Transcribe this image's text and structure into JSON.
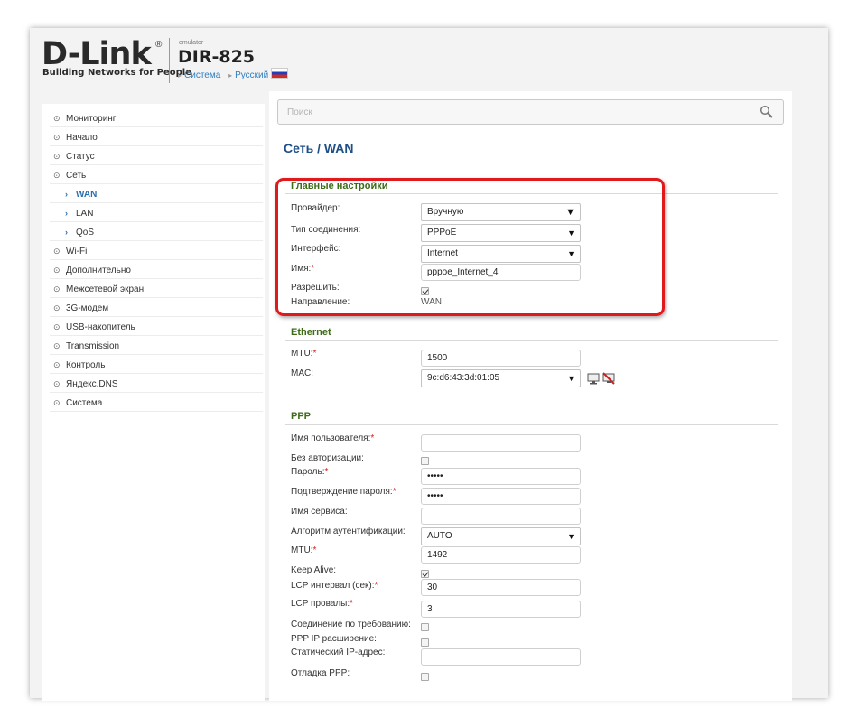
{
  "header": {
    "brand": "D-Link",
    "registered": "®",
    "tagline": "Building Networks for People",
    "emulator_label": "emulator",
    "model": "DIR-825",
    "link_system": "Система",
    "link_language": "Русский"
  },
  "sidebar": {
    "items": [
      {
        "label": "Мониторинг"
      },
      {
        "label": "Начало"
      },
      {
        "label": "Статус"
      },
      {
        "label": "Сеть"
      },
      {
        "label": "WAN"
      },
      {
        "label": "LAN"
      },
      {
        "label": "QoS"
      },
      {
        "label": "Wi-Fi"
      },
      {
        "label": "Дополнительно"
      },
      {
        "label": "Межсетевой экран"
      },
      {
        "label": "3G-модем"
      },
      {
        "label": "USB-накопитель"
      },
      {
        "label": "Transmission"
      },
      {
        "label": "Контроль"
      },
      {
        "label": "Яндекс.DNS"
      },
      {
        "label": "Система"
      }
    ]
  },
  "search": {
    "placeholder": "Поиск"
  },
  "page": {
    "title": "Сеть /  WAN"
  },
  "main_settings": {
    "heading": "Главные настройки",
    "provider_label": "Провайдер:",
    "provider_value": "Вручную",
    "conn_type_label": "Тип соединения:",
    "conn_type_value": "PPPoE",
    "interface_label": "Интерфейс:",
    "interface_value": "Internet",
    "name_label": "Имя:",
    "name_value": "pppoe_Internet_4",
    "enable_label": "Разрешить:",
    "enable_checked": true,
    "direction_label": "Направление:",
    "direction_value": "WAN"
  },
  "ethernet": {
    "heading": "Ethernet",
    "mtu_label": "MTU:",
    "mtu_value": "1500",
    "mac_label": "MAC:",
    "mac_value": "9c:d6:43:3d:01:05"
  },
  "ppp": {
    "heading": "PPP",
    "username_label": "Имя пользователя:",
    "username_value": "",
    "noauth_label": "Без авторизации:",
    "password_label": "Пароль:",
    "password_value": "•••••",
    "confirm_label": "Подтверждение пароля:",
    "confirm_value": "•••••",
    "service_label": "Имя сервиса:",
    "service_value": "",
    "auth_algo_label": "Алгоритм аутентификации:",
    "auth_algo_value": "AUTO",
    "mtu_label": "MTU:",
    "mtu_value": "1492",
    "keepalive_label": "Keep Alive:",
    "keepalive_checked": true,
    "lcp_interval_label": "LCP интервал (сек):",
    "lcp_interval_value": "30",
    "lcp_fails_label": "LCP провалы:",
    "lcp_fails_value": "3",
    "on_demand_label": "Соединение по требованию:",
    "ip_ext_label": "PPP IP расширение:",
    "static_ip_label": "Статический IP-адрес:",
    "static_ip_value": "",
    "debug_label": "Отладка PPP:"
  },
  "colors": {
    "accent": "#2a6fb0",
    "section_heading": "#3d6b17",
    "highlight_box": "#e0191d",
    "required_star": "#d02020"
  }
}
